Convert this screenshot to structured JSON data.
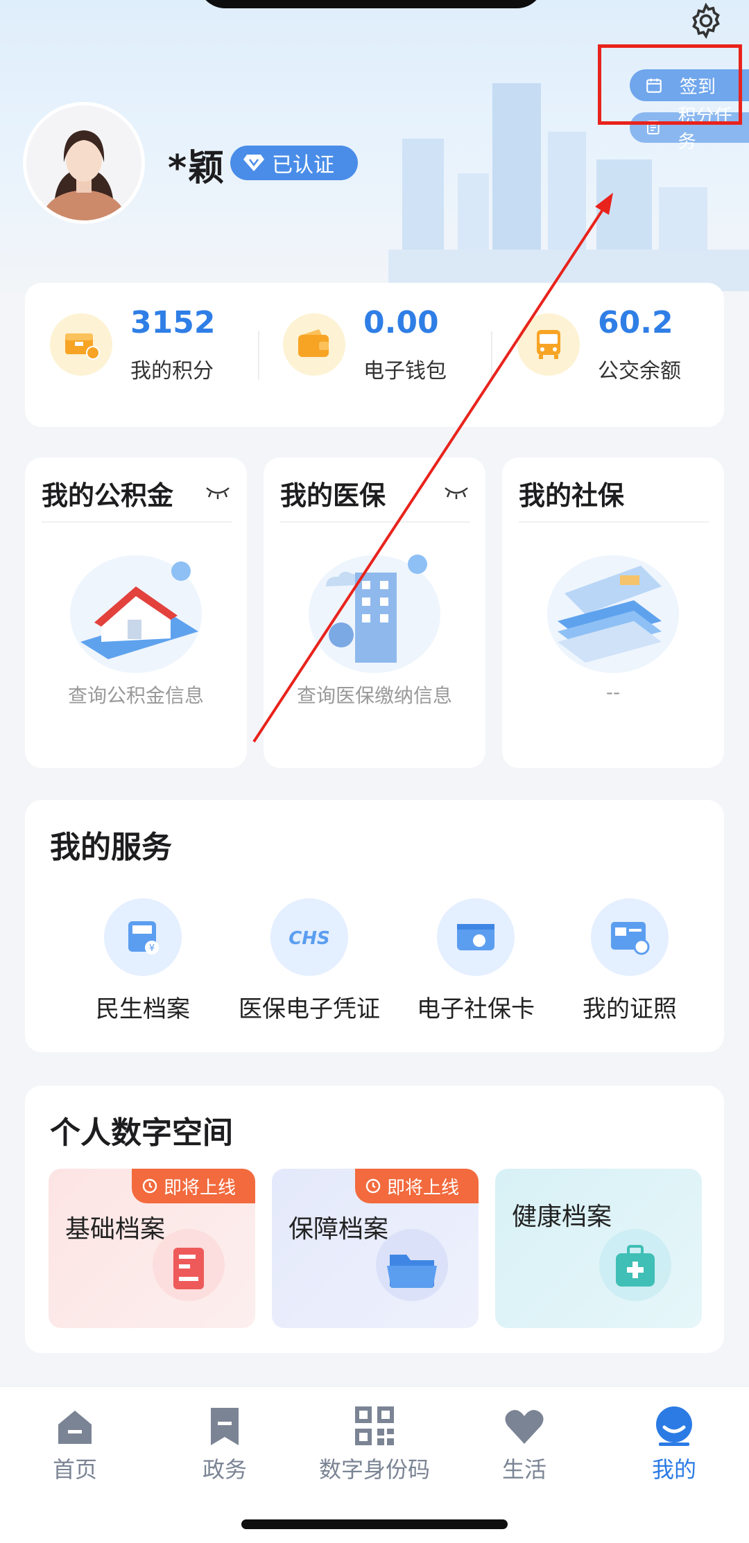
{
  "header": {
    "sign_in_label": "签到",
    "points_task_label": "积分任务",
    "username": "*颖",
    "verified_label": "已认证"
  },
  "stats": [
    {
      "value": "3152",
      "label": "我的积分",
      "icon": "points-box-icon"
    },
    {
      "value": "0.00",
      "label": "电子钱包",
      "icon": "wallet-icon"
    },
    {
      "value": "60.2",
      "label": "公交余额",
      "icon": "bus-icon"
    }
  ],
  "mini_cards": [
    {
      "title": "我的公积金",
      "subtitle": "查询公积金信息",
      "icon": "house-illustration"
    },
    {
      "title": "我的医保",
      "subtitle": "查询医保缴纳信息",
      "icon": "hospital-illustration"
    },
    {
      "title": "我的社保",
      "subtitle": "--",
      "icon": "social-security-illustration"
    }
  ],
  "services": {
    "title": "我的服务",
    "items": [
      {
        "label": "民生档案",
        "icon": "archive-icon"
      },
      {
        "label": "医保电子凭证",
        "icon": "chs-icon"
      },
      {
        "label": "电子社保卡",
        "icon": "social-card-icon"
      },
      {
        "label": "我的证照",
        "icon": "license-icon"
      }
    ]
  },
  "digital_space": {
    "title": "个人数字空间",
    "items": [
      {
        "label": "基础档案",
        "badge": "即将上线",
        "color": "#fde4e4"
      },
      {
        "label": "保障档案",
        "badge": "即将上线",
        "color": "#e4e9fb"
      },
      {
        "label": "健康档案",
        "badge": "",
        "color": "#dcf3f7"
      }
    ]
  },
  "tabbar": {
    "items": [
      {
        "label": "首页",
        "icon": "home-icon"
      },
      {
        "label": "政务",
        "icon": "bookmark-icon"
      },
      {
        "label": "数字身份码",
        "icon": "qr-code-icon"
      },
      {
        "label": "生活",
        "icon": "heart-icon"
      },
      {
        "label": "我的",
        "icon": "profile-icon",
        "active": true
      }
    ]
  },
  "colors": {
    "accent": "#2c7be5",
    "annotation_red": "#e8231c",
    "badge_orange": "#f26a3d"
  }
}
